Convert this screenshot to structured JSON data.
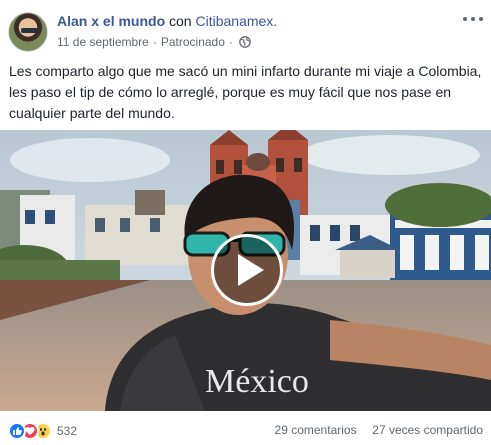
{
  "post": {
    "author": "Alan x el mundo",
    "with_word": "con",
    "brand": "Citibanamex.",
    "date": "11 de septiembre",
    "separator": "·",
    "sponsored": "Patrocinado",
    "text": "Les comparto algo que me sacó un mini infarto durante mi viaje a Colombia, les paso el tip de cómo lo arreglé, porque es muy fácil que nos pase en cualquier parte del mundo.",
    "video_shirt_text": "México"
  },
  "footer": {
    "reaction_count": "532",
    "comments": "29 comentarios",
    "shares": "27 veces compartido"
  },
  "colors": {
    "link": "#385898",
    "meta": "#606770",
    "like": "#1877f2",
    "love": "#f33e58",
    "wow": "#fcd34d"
  },
  "icons": {
    "privacy": "globe-icon",
    "options": "more-options-icon",
    "play": "play-icon"
  }
}
